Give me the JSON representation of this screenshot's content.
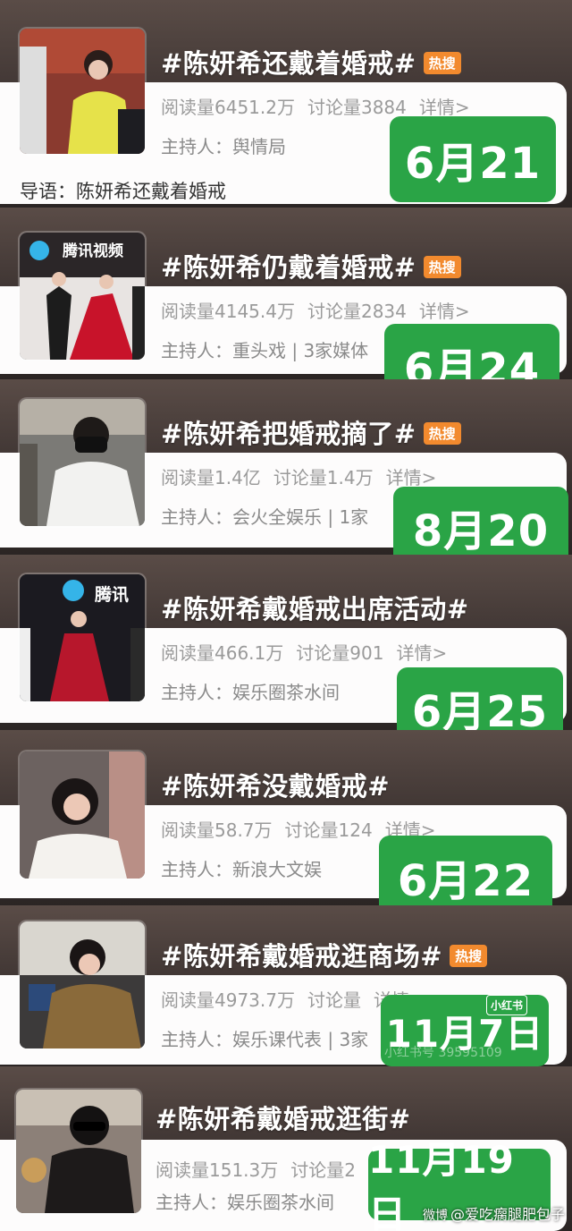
{
  "colors": {
    "badge": "#f28a2e",
    "date_box": "#2aa446",
    "card": "#fdfcfc"
  },
  "items": [
    {
      "title": "#陈妍希还戴着婚戒#",
      "badge": "热搜",
      "reads": "阅读量6451.2万",
      "discuss": "讨论量3884",
      "detail": "详情>",
      "host": "主持人：舆情局",
      "intro": "导语：陈妍希还戴着婚戒",
      "date": "6月21"
    },
    {
      "title": "#陈妍希仍戴着婚戒#",
      "badge": "热搜",
      "thumb_logo": "腾讯视频",
      "reads": "阅读量4145.4万",
      "discuss": "讨论量2834",
      "detail": "详情>",
      "host": "主持人：重头戏 | 3家媒体",
      "date": "6月24"
    },
    {
      "title": "#陈妍希把婚戒摘了#",
      "badge": "热搜",
      "reads": "阅读量1.4亿",
      "discuss": "讨论量1.4万",
      "detail": "详情>",
      "host": "主持人：会火全娱乐 | 1家",
      "date": "8月20"
    },
    {
      "title": "#陈妍希戴婚戒出席活动#",
      "thumb_logo": "腾讯",
      "reads": "阅读量466.1万",
      "discuss": "讨论量901",
      "detail": "详情>",
      "host": "主持人：娱乐圈茶水间",
      "date": "6月25"
    },
    {
      "title": "#陈妍希没戴婚戒#",
      "reads": "阅读量58.7万",
      "discuss": "讨论量124",
      "detail": "详情>",
      "host": "主持人：新浪大文娱",
      "date": "6月22"
    },
    {
      "title": "#陈妍希戴婚戒逛商场#",
      "badge": "热搜",
      "reads": "阅读量4973.7万",
      "discuss": "讨论量",
      "detail": "详情",
      "host": "主持人：娱乐课代表 | 3家",
      "date": "11月7日",
      "xhs_tag": "小红书",
      "faint_text": "小红书号 39595109"
    },
    {
      "title": "#陈妍希戴婚戒逛街#",
      "reads": "阅读量151.3万",
      "discuss": "讨论量2",
      "host": "主持人：娱乐圈茶水间",
      "date": "11月19日"
    }
  ],
  "watermark": {
    "platform": "微博",
    "text": "@爱吃瘸腿肥包子"
  }
}
